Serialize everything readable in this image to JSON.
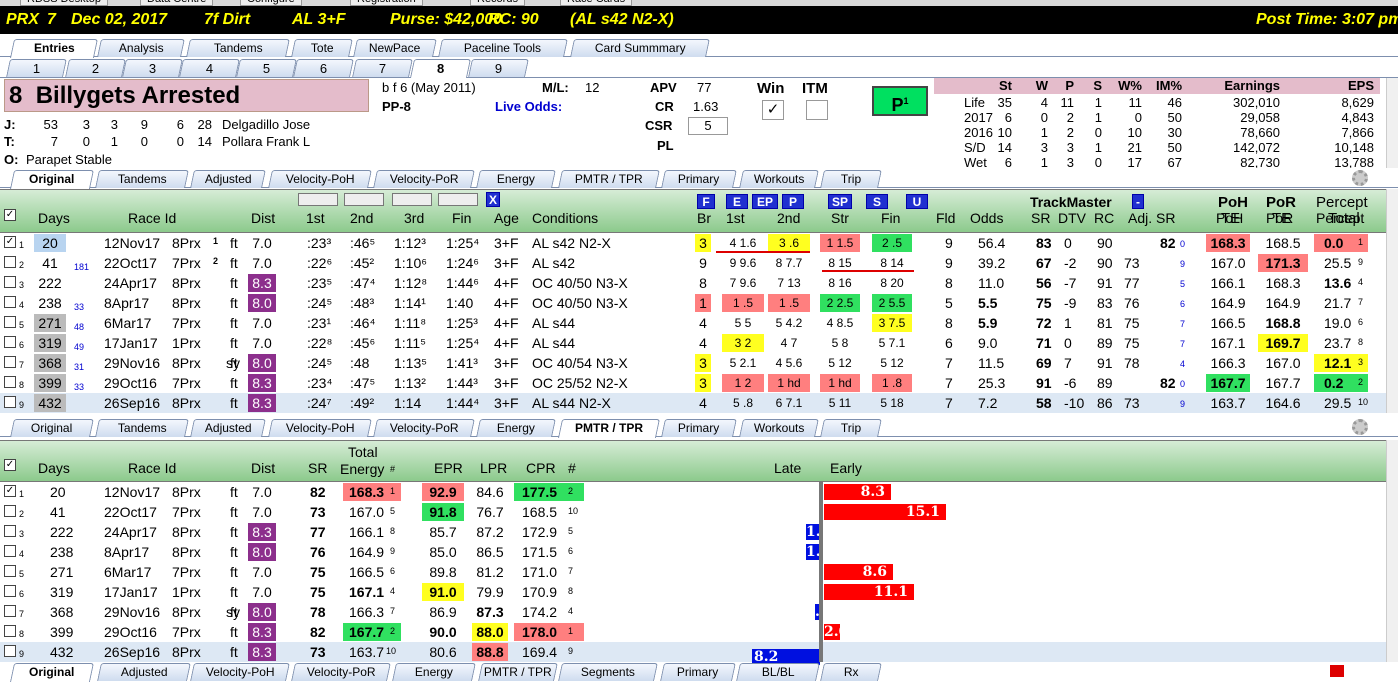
{
  "window_tabs": [
    "RDSS Desktop",
    "Data Centre",
    "Configure",
    "Registration",
    "Records",
    "Race Cards"
  ],
  "race": {
    "track": "PRX",
    "num": "7",
    "date": "Dec 02, 2017",
    "dist": "7f Dirt",
    "type": "AL 3+F",
    "purse": "Purse: $42,000",
    "rc": "RC: 90",
    "cond": "(AL s42 N2-X)",
    "post": "Post Time: 3:07 pm"
  },
  "main_tabs": [
    "Entries",
    "Analysis",
    "Tandems",
    "Tote",
    "NewPace",
    "Paceline Tools",
    "Card Summmary"
  ],
  "number_tabs": [
    "1",
    "2",
    "3",
    "4",
    "5",
    "6",
    "7",
    "8",
    "9"
  ],
  "horse": {
    "num": "8",
    "name": "Billygets Arrested",
    "desc": "b f 6  (May 2011)",
    "pp": "PP-8",
    "ml_label": "M/L:",
    "ml": "12",
    "live_odds": "Live Odds:",
    "j_label": "J:",
    "j_stats": [
      "53",
      "3",
      "3",
      "9",
      "6",
      "28"
    ],
    "jockey": "Delgadillo Jose",
    "t_label": "T:",
    "t_stats": [
      "7",
      "0",
      "1",
      "0",
      "0",
      "14"
    ],
    "trainer": "Pollara Frank L",
    "o_label": "O:",
    "owner": "Parapet Stable",
    "apv_label": "APV",
    "apv": "77",
    "cr_label": "CR",
    "cr": "1.63",
    "csr_label": "CSR",
    "csr": "5",
    "pl_label": "PL",
    "win_label": "Win",
    "itm_label": "ITM",
    "win_check": "✓",
    "p1_label": "P",
    "p1_sup": "1"
  },
  "stats": {
    "headers": [
      "St",
      "W",
      "P",
      "S",
      "W%",
      "IM%",
      "Earnings",
      "EPS"
    ],
    "rows": [
      [
        "Life",
        "35",
        "4",
        "11",
        "1",
        "11",
        "46",
        "302,010",
        "8,629"
      ],
      [
        "2017",
        "6",
        "0",
        "2",
        "1",
        "0",
        "50",
        "29,058",
        "4,843"
      ],
      [
        "2016",
        "10",
        "1",
        "2",
        "0",
        "10",
        "30",
        "78,660",
        "7,866"
      ],
      [
        "S/D",
        "14",
        "3",
        "3",
        "1",
        "21",
        "50",
        "142,072",
        "10,148"
      ],
      [
        "Wet",
        "6",
        "1",
        "3",
        "0",
        "17",
        "67",
        "82,730",
        "13,788"
      ]
    ]
  },
  "sub_tabs": [
    "Original",
    "Tandems",
    "Adjusted",
    "Velocity-PoH",
    "Velocity-PoR",
    "Energy",
    "PMTR / TPR",
    "Primary",
    "Workouts",
    "Trip"
  ],
  "sub_tabs_bottom": [
    "Original",
    "Adjusted",
    "Velocity-PoH",
    "Velocity-PoR",
    "Energy",
    "PMTR / TPR",
    "Segments",
    "Primary",
    "BL/BL",
    "Rx"
  ],
  "top_headers": {
    "days": "Days",
    "raceid": "Race Id",
    "dist": "Dist",
    "q1": "1st",
    "q2": "2nd",
    "q3": "3rd",
    "fin": "Fin",
    "age": "Age",
    "cond": "Conditions",
    "br": "Br",
    "p1": "1st",
    "p2": "2nd",
    "str": "Str",
    "pfin": "Fin",
    "fld": "Fld",
    "odds": "Odds",
    "tm": "TrackMaster",
    "sr": "SR",
    "dtv": "DTV",
    "rc": "RC",
    "adjsr": "Adj. SR",
    "poh": "PoH",
    "poh2": "TE",
    "por": "PoR",
    "por2": "TE",
    "pct": "Percept",
    "pct2": "Total",
    "x": "X",
    "minus": "-"
  },
  "pace_btns": [
    "F",
    "E",
    "EP",
    "P",
    "SP",
    "S",
    "U"
  ],
  "top_rows": [
    {
      "n": "1",
      "days": "20",
      "gap": "",
      "d": "12Nov17",
      "trk": "8Prx",
      "ex": "1",
      "sf": "",
      "dist": "7.0",
      "q1": ":23³",
      "q2": ":46⁵",
      "q3": "1:12³",
      "fin": "1:25⁴",
      "age": "3+F",
      "cond": "AL s42 N2-X",
      "br": "3",
      "p1": "4 1.6",
      "p2": "3 .6",
      "str": "1 1.5",
      "pfin": "2 .5",
      "fld": "9",
      "odds": "56.4",
      "sr": "83",
      "dtv": "0",
      "rc": "90",
      "adj": "82",
      "adjs": "0",
      "poh": "168.3",
      "por": "168.5",
      "pct": "0.0",
      "pcts": "1"
    },
    {
      "n": "2",
      "days": "41",
      "gap": "181",
      "d": "22Oct17",
      "trk": "7Prx",
      "ex": "2",
      "sf": "",
      "dist": "7.0",
      "q1": ":22⁶",
      "q2": ":45²",
      "q3": "1:10⁶",
      "fin": "1:24⁶",
      "age": "3+F",
      "cond": "AL s42",
      "br": "9",
      "p1": "9 9.6",
      "p2": "8 7.7",
      "str": "8 15",
      "pfin": "8 14",
      "fld": "9",
      "odds": "39.2",
      "sr": "67",
      "dtv": "-2",
      "rc": "90",
      "adj": "73",
      "adjs": "9",
      "poh": "167.0",
      "por": "171.3",
      "pct": "25.5",
      "pcts": "9"
    },
    {
      "n": "3",
      "days": "222",
      "gap": "",
      "d": "24Apr17",
      "trk": "8Prx",
      "ex": "",
      "sf": "",
      "dist": "8.3",
      "q1": ":23⁵",
      "q2": ":47⁴",
      "q3": "1:12⁸",
      "fin": "1:44⁶",
      "age": "4+F",
      "cond": "OC 40/50 N3-X",
      "br": "8",
      "p1": "7 9.6",
      "p2": "7 13",
      "str": "8 16",
      "pfin": "8 20",
      "fld": "8",
      "odds": "11.0",
      "sr": "56",
      "dtv": "-7",
      "rc": "91",
      "adj": "77",
      "adjs": "5",
      "poh": "166.1",
      "por": "168.3",
      "pct": "13.6",
      "pcts": "4"
    },
    {
      "n": "4",
      "days": "238",
      "gap": "33",
      "d": "8Apr17",
      "trk": "8Prx",
      "ex": "",
      "sf": "",
      "dist": "8.0",
      "q1": ":24⁵",
      "q2": ":48³",
      "q3": "1:14¹",
      "fin": "1:40",
      "age": "4+F",
      "cond": "OC 40/50 N3-X",
      "br": "1",
      "p1": "1 .5",
      "p2": "1 .5",
      "str": "2 2.5",
      "pfin": "2 5.5",
      "fld": "5",
      "odds": "5.5",
      "sr": "75",
      "dtv": "-9",
      "rc": "83",
      "adj": "76",
      "adjs": "6",
      "poh": "164.9",
      "por": "164.9",
      "pct": "21.7",
      "pcts": "7"
    },
    {
      "n": "5",
      "days": "271",
      "gap": "48",
      "d": "6Mar17",
      "trk": "7Prx",
      "ex": "",
      "sf": "",
      "dist": "7.0",
      "q1": ":23¹",
      "q2": ":46⁴",
      "q3": "1:11⁸",
      "fin": "1:25³",
      "age": "4+F",
      "cond": "AL s44",
      "br": "4",
      "p1": "5 5",
      "p2": "5 4.2",
      "str": "4 8.5",
      "pfin": "3 7.5",
      "fld": "8",
      "odds": "5.9",
      "sr": "72",
      "dtv": "1",
      "rc": "81",
      "adj": "75",
      "adjs": "7",
      "poh": "166.5",
      "por": "168.8",
      "pct": "19.0",
      "pcts": "6"
    },
    {
      "n": "6",
      "days": "319",
      "gap": "49",
      "d": "17Jan17",
      "trk": "1Prx",
      "ex": "",
      "sf": "",
      "dist": "7.0",
      "q1": ":22⁸",
      "q2": ":45⁶",
      "q3": "1:11⁵",
      "fin": "1:25⁴",
      "age": "4+F",
      "cond": "AL s44",
      "br": "4",
      "p1": "3 2",
      "p2": "4 7",
      "str": "5 8",
      "pfin": "5 7.1",
      "fld": "6",
      "odds": "9.0",
      "sr": "71",
      "dtv": "0",
      "rc": "89",
      "adj": "75",
      "adjs": "7",
      "poh": "167.1",
      "por": "169.7",
      "pct": "23.7",
      "pcts": "8"
    },
    {
      "n": "7",
      "days": "368",
      "gap": "31",
      "d": "29Nov16",
      "trk": "8Prx",
      "ex": "",
      "sf": "sy",
      "dist": "8.0",
      "q1": ":24⁵",
      "q2": ":48",
      "q3": "1:13⁵",
      "fin": "1:41³",
      "age": "3+F",
      "cond": "OC 40/54 N3-X",
      "br": "3",
      "p1": "5 2.1",
      "p2": "4 5.6",
      "str": "5 12",
      "pfin": "5 12",
      "fld": "7",
      "odds": "11.5",
      "sr": "69",
      "dtv": "7",
      "rc": "91",
      "adj": "78",
      "adjs": "4",
      "poh": "166.3",
      "por": "167.0",
      "pct": "12.1",
      "pcts": "3"
    },
    {
      "n": "8",
      "days": "399",
      "gap": "33",
      "d": "29Oct16",
      "trk": "7Prx",
      "ex": "",
      "sf": "",
      "dist": "8.3",
      "q1": ":23⁴",
      "q2": ":47⁵",
      "q3": "1:13²",
      "fin": "1:44³",
      "age": "3+F",
      "cond": "OC 25/52 N2-X",
      "br": "3",
      "p1": "1 2",
      "p2": "1 hd",
      "str": "1 hd",
      "pfin": "1 .8",
      "fld": "7",
      "odds": "25.3",
      "sr": "91",
      "dtv": "-6",
      "rc": "89",
      "adj": "82",
      "adjs": "0",
      "poh": "167.7",
      "por": "167.7",
      "pct": "0.2",
      "pcts": "2"
    },
    {
      "n": "9",
      "days": "432",
      "gap": "",
      "d": "26Sep16",
      "trk": "8Prx",
      "ex": "",
      "sf": "",
      "dist": "8.3",
      "q1": ":24⁷",
      "q2": ":49²",
      "q3": "1:14",
      "fin": "1:44⁴",
      "age": "3+F",
      "cond": "AL s44 N2-X",
      "br": "4",
      "p1": "5 .8",
      "p2": "6 7.1",
      "str": "5 11",
      "pfin": "5 18",
      "fld": "7",
      "odds": "7.2",
      "sr": "58",
      "dtv": "-10",
      "rc": "86",
      "adj": "73",
      "adjs": "9",
      "poh": "163.7",
      "por": "164.6",
      "pct": "29.5",
      "pcts": "10"
    }
  ],
  "bot_headers": {
    "days": "Days",
    "raceid": "Race Id",
    "dist": "Dist",
    "sr": "SR",
    "te1": "Total",
    "te2": "Energy",
    "hash": "#",
    "epr": "EPR",
    "lpr": "LPR",
    "cpr": "CPR",
    "hash2": "#",
    "late": "Late",
    "early": "Early"
  },
  "bot_rows": [
    {
      "n": "1",
      "days": "20",
      "d": "12Nov17",
      "trk": "8Prx",
      "sf": "",
      "dist": "7.0",
      "sr": "82",
      "te": "168.3",
      "tes": "1",
      "epr": "92.9",
      "lpr": "84.6",
      "cpr": "177.5",
      "cprs": "2",
      "late": 0,
      "early": 8.3,
      "label": "8.3"
    },
    {
      "n": "2",
      "days": "41",
      "d": "22Oct17",
      "trk": "7Prx",
      "sf": "",
      "dist": "7.0",
      "sr": "73",
      "te": "167.0",
      "tes": "5",
      "epr": "91.8",
      "lpr": "76.7",
      "cpr": "168.5",
      "cprs": "10",
      "late": 0,
      "early": 15.1,
      "label": "15.1"
    },
    {
      "n": "3",
      "days": "222",
      "d": "24Apr17",
      "trk": "8Prx",
      "sf": "",
      "dist": "8.3",
      "sr": "77",
      "te": "166.1",
      "tes": "8",
      "epr": "85.7",
      "lpr": "87.2",
      "cpr": "172.9",
      "cprs": "5",
      "late": 1.5,
      "early": 0,
      "label": "1.5"
    },
    {
      "n": "4",
      "days": "238",
      "d": "8Apr17",
      "trk": "8Prx",
      "sf": "",
      "dist": "8.0",
      "sr": "76",
      "te": "164.9",
      "tes": "9",
      "epr": "85.0",
      "lpr": "86.5",
      "cpr": "171.5",
      "cprs": "6",
      "late": 1.5,
      "early": 0,
      "label": "1.5"
    },
    {
      "n": "5",
      "days": "271",
      "d": "6Mar17",
      "trk": "7Prx",
      "sf": "",
      "dist": "7.0",
      "sr": "75",
      "te": "166.5",
      "tes": "6",
      "epr": "89.8",
      "lpr": "81.2",
      "cpr": "171.0",
      "cprs": "7",
      "late": 0,
      "early": 8.6,
      "label": "8.6"
    },
    {
      "n": "6",
      "days": "319",
      "d": "17Jan17",
      "trk": "1Prx",
      "sf": "",
      "dist": "7.0",
      "sr": "75",
      "te": "167.1",
      "tes": "4",
      "epr": "91.0",
      "lpr": "79.9",
      "cpr": "170.9",
      "cprs": "8",
      "late": 0,
      "early": 11.1,
      "label": "11.1"
    },
    {
      "n": "7",
      "days": "368",
      "d": "29Nov16",
      "trk": "8Prx",
      "sf": "sy",
      "dist": "8.0",
      "sr": "78",
      "te": "166.3",
      "tes": "7",
      "epr": "86.9",
      "lpr": "87.3",
      "cpr": "174.2",
      "cprs": "4",
      "late": 0.4,
      "early": 0,
      "label": ".4"
    },
    {
      "n": "8",
      "days": "399",
      "d": "29Oct16",
      "trk": "7Prx",
      "sf": "",
      "dist": "8.3",
      "sr": "82",
      "te": "167.7",
      "tes": "2",
      "epr": "90.0",
      "lpr": "88.0",
      "cpr": "178.0",
      "cprs": "1",
      "late": 0,
      "early": 2.0,
      "label": "2.0"
    },
    {
      "n": "9",
      "days": "432",
      "d": "26Sep16",
      "trk": "8Prx",
      "sf": "",
      "dist": "8.3",
      "sr": "73",
      "te": "163.7",
      "tes": "10",
      "epr": "80.6",
      "lpr": "88.8",
      "cpr": "169.4",
      "cprs": "9",
      "late": 8.2,
      "early": 0,
      "label": "8.2"
    }
  ],
  "colors": {
    "green_head": "#8cca8c",
    "yellow": "#ffff20",
    "red": "#ff7f7f",
    "green": "#30e060",
    "purple": "#8c2f8c",
    "early_bar": "#ff0000",
    "late_bar": "#0010e0"
  }
}
